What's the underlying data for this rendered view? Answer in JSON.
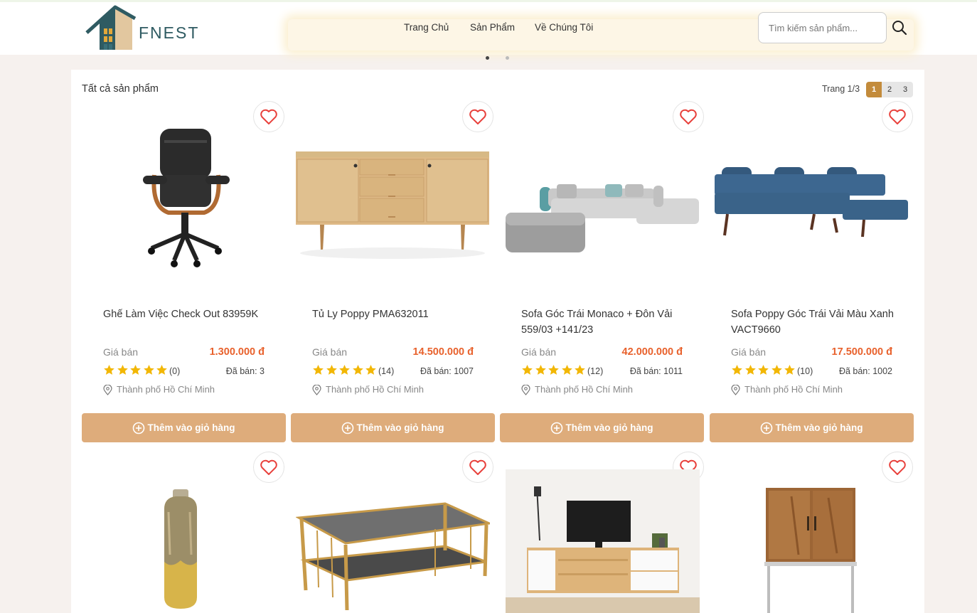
{
  "brand": {
    "name": "FNEST"
  },
  "nav": {
    "home": "Trang Chủ",
    "products": "Sản Phẩm",
    "about": "Về Chúng Tôi"
  },
  "search": {
    "placeholder": "Tìm kiếm sản phẩm...",
    "icon": "search-icon"
  },
  "carousel": {
    "slides": 2,
    "active": 1
  },
  "section": {
    "title": "Tất cả sản phẩm"
  },
  "pagination": {
    "label": "Trang 1/3",
    "pages": [
      "1",
      "2",
      "3"
    ],
    "current": "1"
  },
  "colors": {
    "accent": "#deac7b",
    "price": "#e8612c",
    "star": "#f2b705",
    "heart": "#e8413c",
    "active_page": "#c38b3b"
  },
  "common": {
    "price_label": "Giá bán",
    "add_to_cart": "Thêm vào giỏ hàng",
    "sold_prefix": "Đã bán: "
  },
  "products": [
    {
      "name": "Ghế Làm Việc Check Out 83959K",
      "price": "1.300.000 đ",
      "rating": 5,
      "reviews": "(0)",
      "sold": "Đã bán: 3",
      "location": "Thành phố Hồ Chí Minh"
    },
    {
      "name": "Tủ Ly Poppy PMA632011",
      "price": "14.500.000 đ",
      "rating": 5,
      "reviews": "(14)",
      "sold": "Đã bán: 1007",
      "location": "Thành phố Hồ Chí Minh"
    },
    {
      "name": "Sofa Góc Trái Monaco + Đôn Vải 559/03 +141/23",
      "price": "42.000.000 đ",
      "rating": 5,
      "reviews": "(12)",
      "sold": "Đã bán: 1011",
      "location": "Thành phố Hồ Chí Minh"
    },
    {
      "name": "Sofa Poppy Góc Trái Vải Màu Xanh VACT9660",
      "price": "17.500.000 đ",
      "rating": 5,
      "reviews": "(10)",
      "sold": "Đã bán: 1002",
      "location": "Thành phố Hồ Chí Minh"
    },
    {
      "name": "",
      "price": "",
      "rating": 0,
      "reviews": "",
      "sold": "",
      "location": ""
    },
    {
      "name": "",
      "price": "",
      "rating": 0,
      "reviews": "",
      "sold": "",
      "location": ""
    },
    {
      "name": "",
      "price": "",
      "rating": 0,
      "reviews": "",
      "sold": "",
      "location": ""
    },
    {
      "name": "",
      "price": "",
      "rating": 0,
      "reviews": "",
      "sold": "",
      "location": ""
    }
  ]
}
